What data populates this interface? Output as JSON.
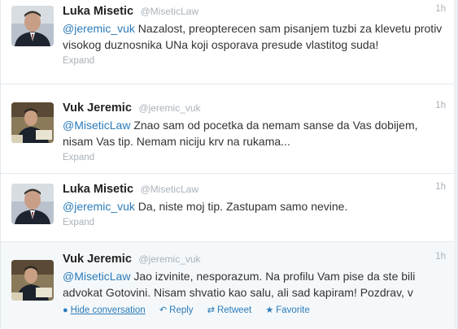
{
  "tweets": [
    {
      "fullname": "Luka Misetic",
      "username": "@MiseticLaw",
      "time": "1h",
      "mention": "@jeremic_vuk",
      "text": " Nazalost, preopterecen sam pisanjem tuzbi za klevetu protiv visokog duznosnika UNa koji osporava presude vlastitog suda!",
      "expand": "Expand"
    },
    {
      "fullname": "Vuk Jeremic",
      "username": "@jeremic_vuk",
      "time": "1h",
      "mention": "@MiseticLaw",
      "text": " Znao sam od pocetka da nemam sanse da Vas dobijem, nisam Vas tip. Nemam niciju krv na rukama...",
      "expand": "Expand"
    },
    {
      "fullname": "Luka Misetic",
      "username": "@MiseticLaw",
      "time": "1h",
      "mention": "@jeremic_vuk",
      "text": " Da, niste moj tip. Zastupam samo nevine.",
      "expand": "Expand"
    },
    {
      "fullname": "Vuk Jeremic",
      "username": "@jeremic_vuk",
      "time": "1h",
      "mention": "@MiseticLaw",
      "text": " Jao izvinite, nesporazum. Na profilu Vam pise da ste bili advokat Gotovini. Nisam shvatio kao salu, ali sad kapiram! Pozdrav, v",
      "actions": {
        "hide": "Hide conversation",
        "reply": "Reply",
        "retweet": "Retweet",
        "favorite": "Favorite"
      }
    }
  ],
  "colors": {
    "link": "#2b7bb9",
    "muted": "#a8b2bb",
    "border": "#e1e8ed"
  },
  "icons": [
    "conversation-icon",
    "reply-icon",
    "retweet-icon",
    "favorite-icon"
  ]
}
